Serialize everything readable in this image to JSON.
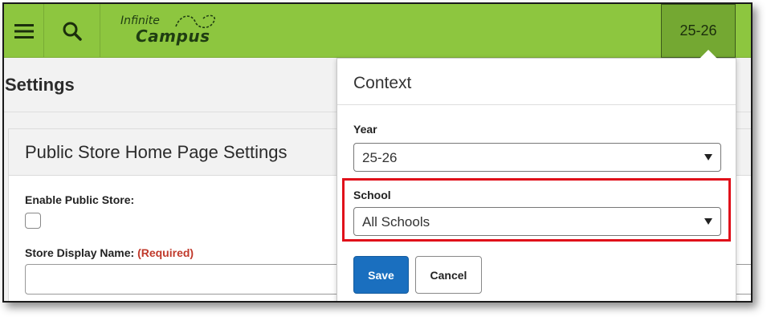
{
  "topbar": {
    "logo_line1": "Infinite",
    "logo_line2": "Campus",
    "year_label": "25-26",
    "icons": {
      "menu": "hamburger-menu-icon",
      "search": "search-icon"
    },
    "background_color": "#8dc63f"
  },
  "page": {
    "title": "Settings",
    "section_title": "Public Store Home Page Settings",
    "enable_store_label": "Enable Public Store:",
    "enable_store_checked": false,
    "display_name_label": "Store Display Name:",
    "display_name_required": "(Required)",
    "display_name_value": ""
  },
  "context_panel": {
    "title": "Context",
    "year_label": "Year",
    "year_value": "25-26",
    "school_label": "School",
    "school_value": "All Schools",
    "save_label": "Save",
    "cancel_label": "Cancel",
    "save_color": "#1a6fbf",
    "highlight_color": "#e0101a"
  }
}
